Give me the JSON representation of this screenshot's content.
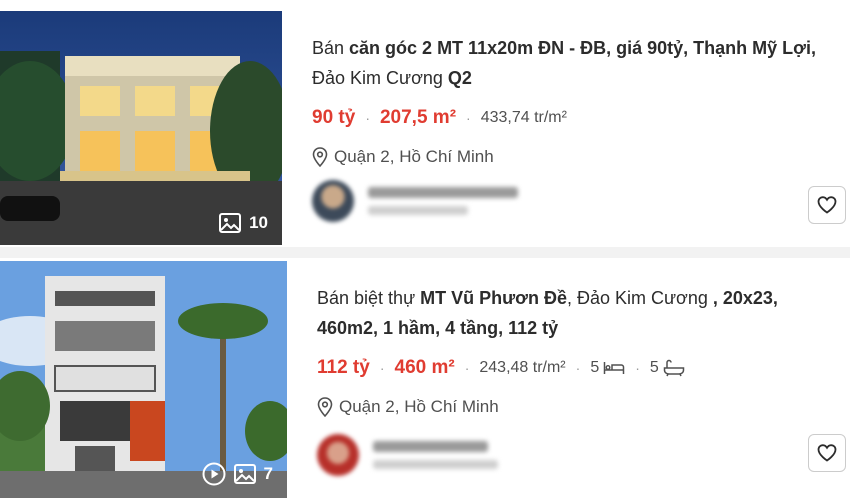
{
  "listings": [
    {
      "title_parts": [
        {
          "text": "Bán ",
          "bold": false
        },
        {
          "text": "căn góc 2 MT 11x20m ĐN - ĐB, giá 90tỷ, Thạnh Mỹ Lợi,",
          "bold": true
        },
        {
          "text": " Đảo Kim Cương ",
          "bold": false
        },
        {
          "text": "Q2",
          "bold": true
        }
      ],
      "price": "90 tỷ",
      "area": "207,5 m²",
      "price_per_m2": "433,74 tr/m²",
      "location": "Quận 2, Hồ Chí Minh",
      "photo_count": "10",
      "has_video": false,
      "bedrooms": null,
      "bathrooms": null,
      "agent_name": "Nguyễn Hoàng Thắng",
      "agent_sub": "Đăng hôm qua"
    },
    {
      "title_parts": [
        {
          "text": "Bán biệt thự ",
          "bold": false
        },
        {
          "text": "MT Vũ Phươn Đề",
          "bold": true
        },
        {
          "text": ", Đảo Kim Cương ",
          "bold": false
        },
        {
          "text": ", 20x23, 460m2, 1 hầm, 4 tầng, 112 tỷ",
          "bold": true
        }
      ],
      "price": "112 tỷ",
      "area": "460 m²",
      "price_per_m2": "243,48 tr/m²",
      "location": "Quận 2, Hồ Chí Minh",
      "photo_count": "7",
      "has_video": true,
      "bedrooms": "5",
      "bathrooms": "5",
      "agent_name": "Lâm Thành Quốc",
      "agent_sub": "Đăng 1 tuần trước"
    }
  ],
  "colors": {
    "price": "#e03c31",
    "text": "#2c2c2c",
    "muted": "#505050"
  },
  "icons": {
    "photos": "image-icon",
    "video": "play-circle-icon",
    "location": "location-pin-icon",
    "favorite": "heart-icon",
    "bed": "bed-icon",
    "bath": "bath-icon"
  }
}
